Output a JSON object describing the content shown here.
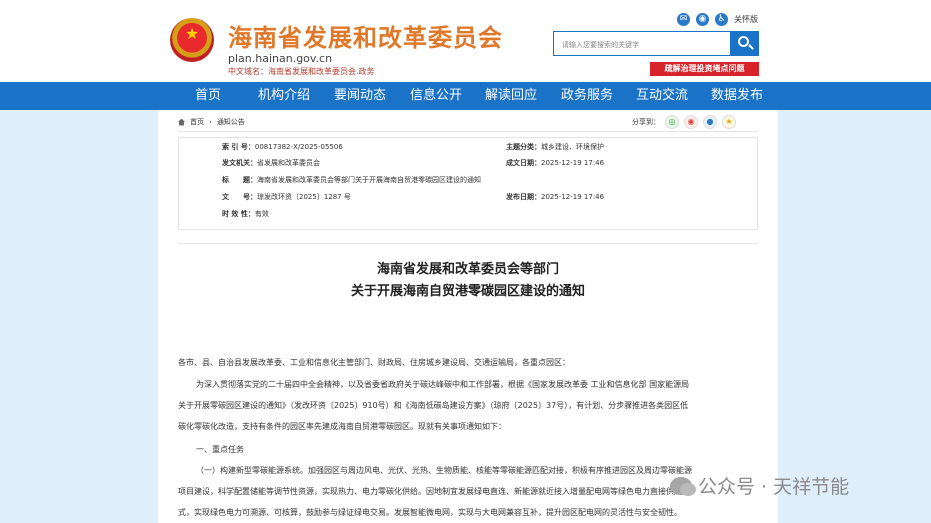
{
  "header": {
    "site_title": "海南省发展和改革委员会",
    "domain": "plan.hainan.gov.cn",
    "cn_domain": "中文域名：海南省发展和改革委员会.政务",
    "care_label": "关怀版",
    "search_placeholder": "请输入您要搜索的关键字",
    "red_link": "疏解治理投资堵点问题"
  },
  "nav": [
    "首页",
    "机构介绍",
    "要闻动态",
    "信息公开",
    "解读回应",
    "政务服务",
    "互动交流",
    "数据发布"
  ],
  "breadcrumb": {
    "home": "首页",
    "sep": "›",
    "current": "通知公告"
  },
  "share_label": "分享到：",
  "meta": {
    "index_label": "索 引 号：",
    "index_value": "00817382-X/2025-05506",
    "category_label": "主题分类：",
    "category_value": "城乡建设、环境保护",
    "issuer_label": "发文机关：",
    "issuer_value": "省发展和改革委员会",
    "created_label": "成文日期：",
    "created_value": "2025-12-19 17:46",
    "title_label": "标　　题：",
    "title_value": "海南省发展和改革委员会等部门关于开展海南自贸港零碳园区建设的通知",
    "docno_label": "文　　号：",
    "docno_value": "琼发改环资〔2025〕1287 号",
    "published_label": "发布日期：",
    "published_value": "2025-12-19 17:46",
    "validity_label": "时 效 性：",
    "validity_value": "有效"
  },
  "doc": {
    "title_line1": "海南省发展和改革委员会等部门",
    "title_line2": "关于开展海南自贸港零碳园区建设的通知",
    "p1": "各市、县、自治县发展改革委、工业和信息化主管部门、财政局、住房城乡建设局、交通运输局，各重点园区：",
    "p2a": "为深入贯彻落实党的二十届四中全会精神，以及省委省政府关于碳达峰碳中和工作部署，根据《国家发展改革委 工业和信息化部 国家能源局",
    "p2b": "关于开展零碳园区建设的通知》（发改环资〔2025〕910号）和《海南低碳岛建设方案》（琼府〔2025〕37号），有计划、分步骤推进各类园区低",
    "p2c": "碳化零碳化改造，支持有条件的园区率先建成海南自贸港零碳园区。现就有关事项通知如下：",
    "h1": "一、重点任务",
    "p3a": "（一）构建新型零碳能源系统。加强园区与周边风电、光伏、光热、生物质能、核能等零碳能源匹配对接，积极有序推进园区及周边零碳能源",
    "p3b": "项目建设，科学配置储能等调节性资源，实现热力、电力零碳化供给。因地制宜发展绿电直连、新能源就近接入增量配电网等绿色电力直接供应模",
    "p3c": "式，实现绿色电力可溯源、可核算，鼓励参与绿证绿电交易。发展智能微电网，实现与大电网兼容互补，提升园区配电网的灵活性与安全韧性。"
  },
  "watermark": "公众号 · 天祥节能"
}
